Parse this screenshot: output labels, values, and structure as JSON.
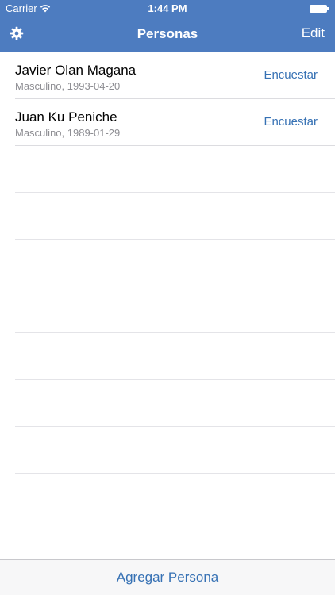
{
  "status_bar": {
    "carrier": "Carrier",
    "time": "1:44 PM"
  },
  "nav_bar": {
    "title": "Personas",
    "edit_label": "Edit",
    "settings_icon": "gear-icon"
  },
  "people": [
    {
      "name": "Javier Olan Magana",
      "detail": "Masculino, 1993-04-20",
      "action": "Encuestar"
    },
    {
      "name": "Juan Ku Peniche",
      "detail": "Masculino, 1989-01-29",
      "action": "Encuestar"
    }
  ],
  "toolbar": {
    "add_label": "Agregar Persona"
  },
  "colors": {
    "nav_background": "#4d7cc0",
    "accent": "#3671b4",
    "subtitle": "#8e8e93"
  }
}
